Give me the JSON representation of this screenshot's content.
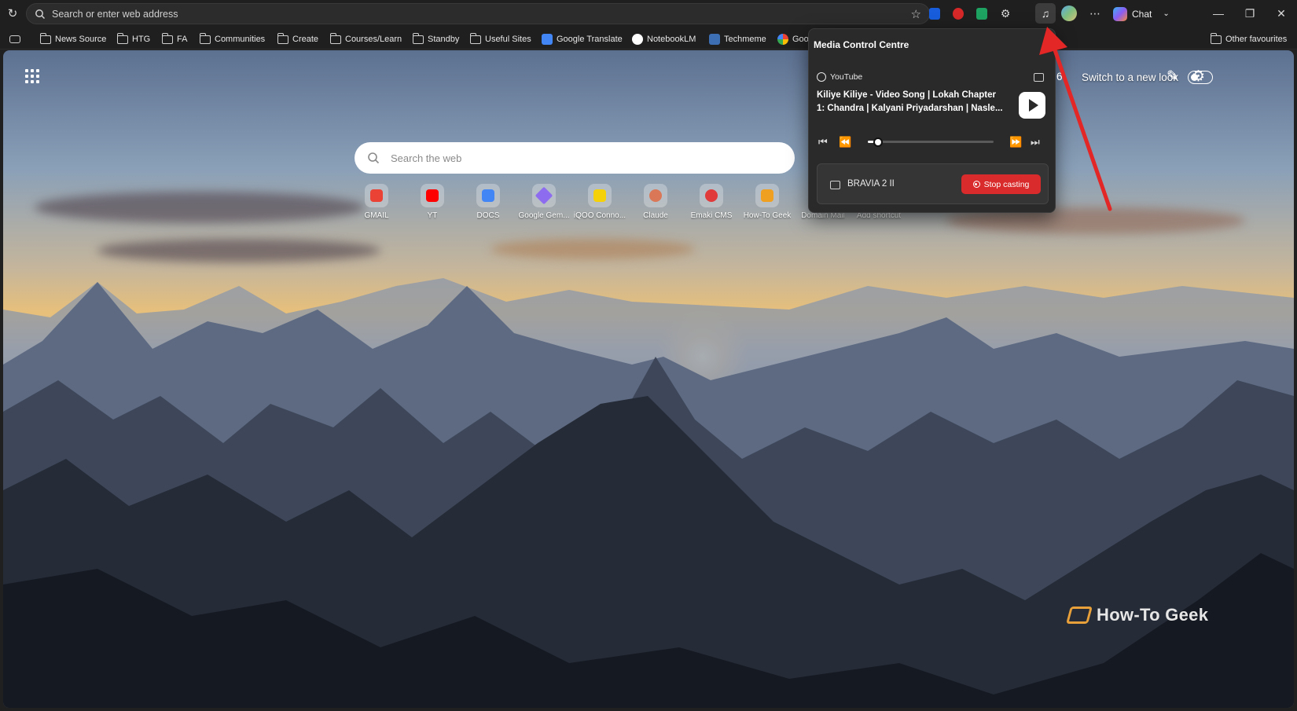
{
  "browser": {
    "address_placeholder": "Search or enter web address",
    "chat_label": "Chat"
  },
  "bookmarks": [
    {
      "label": "News Source",
      "type": "folder"
    },
    {
      "label": "HTG",
      "type": "folder"
    },
    {
      "label": "FA",
      "type": "folder"
    },
    {
      "label": "Communities",
      "type": "folder"
    },
    {
      "label": "Create",
      "type": "folder"
    },
    {
      "label": "Courses/Learn",
      "type": "folder"
    },
    {
      "label": "Standby",
      "type": "folder"
    },
    {
      "label": "Useful Sites",
      "type": "folder"
    },
    {
      "label": "Google Translate",
      "type": "site"
    },
    {
      "label": "NotebookLM",
      "type": "site"
    },
    {
      "label": "Techmeme",
      "type": "site"
    },
    {
      "label": "Goo",
      "type": "site"
    }
  ],
  "other_favourites": "Other favourites",
  "newtab": {
    "search_placeholder": "Search the web",
    "switch_label": "Switch to a new look",
    "shortcuts": [
      {
        "label": "GMAIL",
        "color": "#ea4335"
      },
      {
        "label": "YT",
        "color": "#ff0000"
      },
      {
        "label": "DOCS",
        "color": "#4285f4"
      },
      {
        "label": "Google Gem...",
        "color": "#8e6cf0"
      },
      {
        "label": "iQOO Conno...",
        "color": "#f5d10a"
      },
      {
        "label": "Claude",
        "color": "#d97757"
      },
      {
        "label": "Emaki CMS",
        "color": "#e03a3a"
      },
      {
        "label": "How-To Geek",
        "color": "#f0a020"
      },
      {
        "label": "Domain Mail",
        "color": "#9aa0a6"
      },
      {
        "label": "Add shortcut",
        "color": "#cccccc"
      }
    ]
  },
  "media_control": {
    "title": "Media Control Centre",
    "source": "YouTube",
    "track_line1": "Kiliye Kiliye - Video Song | Lokah Chapter",
    "track_line2": "1: Chandra | Kalyani Priyadarshan | Nasle...",
    "progress": 0.08,
    "cast_device": "BRAVIA 2 II",
    "stop_casting_label": "Stop casting",
    "partial_text": "6"
  },
  "watermark": "How-To Geek",
  "colors": {
    "stop_casting": "#d92b2b",
    "annotation_arrow": "#e32626"
  }
}
